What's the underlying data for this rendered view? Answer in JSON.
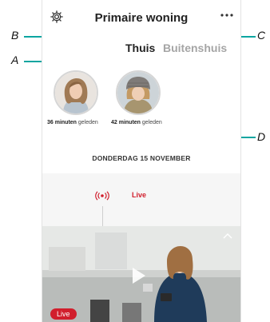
{
  "header": {
    "title": "Primaire woning"
  },
  "tabs": [
    {
      "label": "Thuis"
    },
    {
      "label": "Buitenshuis"
    }
  ],
  "people": [
    {
      "minutes": "36 minuten",
      "suffix": " geleden"
    },
    {
      "minutes": "42 minuten",
      "suffix": " geleden"
    }
  ],
  "timeline": {
    "date": "DONDERDAG 15 NOVEMBER",
    "live_label": "Live"
  },
  "video": {
    "badge": "Live"
  },
  "annotations": {
    "a": "A",
    "b": "B",
    "c": "C",
    "d": "D"
  },
  "colors": {
    "accent_teal": "#0aa5a0",
    "live_red": "#d11e2c"
  },
  "icons": [
    "gear-icon",
    "more-icon",
    "live-signal-icon",
    "chevron-up-icon",
    "play-icon"
  ]
}
